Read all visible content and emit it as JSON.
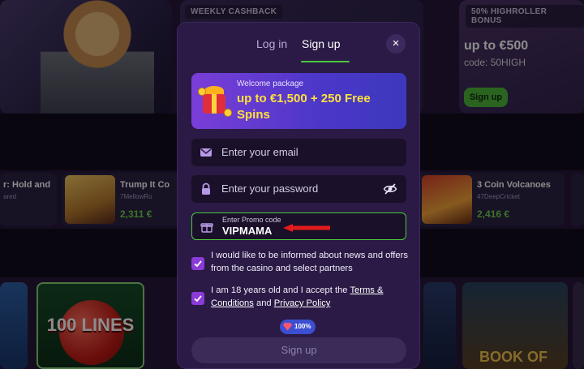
{
  "background": {
    "weekly_tag": "WEEKLY CASHBACK",
    "highroller_tag": "50% HIGHROLLER BONUS",
    "highroller_amount": "up to €500",
    "highroller_code": "code: 50HIGH",
    "highroller_button": "Sign up",
    "game1_title": "r: Hold and",
    "game1_sub": "ared",
    "game2_title": "Trump It Co",
    "game2_sub": "7MellowRo",
    "game2_amount": "2,311 €",
    "game3_title": "3 Coin Volcanoes",
    "game3_sub": "47DeepCricket",
    "game3_amount": "2,416 €",
    "tile_lines": "100 LINES",
    "tile_book": "BOOK OF"
  },
  "modal": {
    "tabs": [
      {
        "label": "Log in"
      },
      {
        "label": "Sign up"
      }
    ],
    "close_icon": "close-icon",
    "welcome": {
      "small": "Welcome package",
      "big": "up to €1,500 + 250 Free Spins"
    },
    "email": {
      "placeholder": "Enter your email"
    },
    "password": {
      "placeholder": "Enter your password"
    },
    "promo": {
      "label": "Enter Promo code",
      "value": "VIPMAMA"
    },
    "consent_news": "I would like to be informed about news and offers from the casino and select partners",
    "consent_age": {
      "prefix": "I am 18 years old and I accept the ",
      "terms": "Terms & Conditions",
      "and": " and ",
      "privacy": "Privacy Policy"
    },
    "badge": "100%",
    "signup_button": "Sign up"
  },
  "colors": {
    "accent_green": "#49c93b",
    "accent_purple": "#8a3bd8",
    "arrow_red": "#e31b1b"
  }
}
